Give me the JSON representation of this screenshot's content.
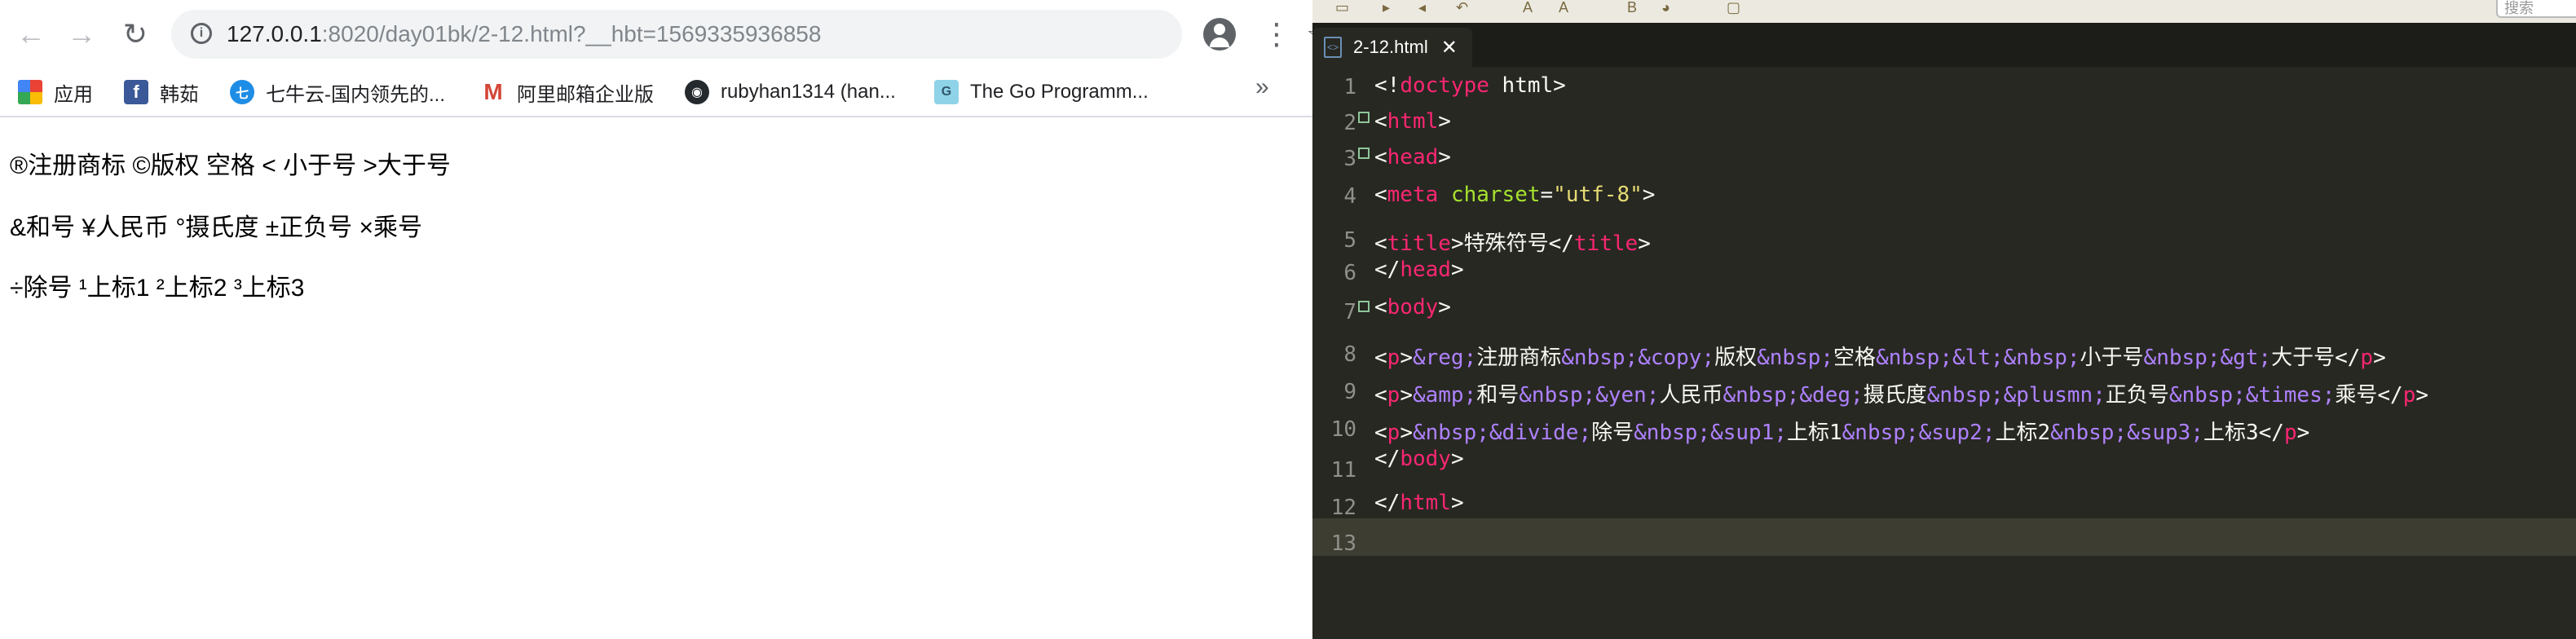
{
  "browser": {
    "url_host": "127.0.0.1",
    "url_rest": ":8020/day01bk/2-12.html?__hbt=1569335936858",
    "bookmarks": [
      {
        "label": "应用",
        "icon": "apps-grid-icon"
      },
      {
        "label": "韩茹",
        "icon": "facebook-icon"
      },
      {
        "label": "七牛云-国内领先的...",
        "icon": "qiniu-icon"
      },
      {
        "label": "阿里邮箱企业版",
        "icon": "gmail-icon"
      },
      {
        "label": "rubyhan1314 (han...",
        "icon": "github-icon"
      },
      {
        "label": "The Go Programm...",
        "icon": "gopher-icon"
      }
    ],
    "more_label": "»",
    "content_lines": [
      "®注册商标 ©版权 空格 < 小于号 >大于号",
      "&和号 ¥人民币 °摄氏度 ±正负号 ×乘号",
      " ÷除号 ¹上标1 ²上标2 ³上标3"
    ]
  },
  "editor": {
    "tab_title": "2-12.html",
    "tab_close": "✕",
    "search_placeholder": "搜索",
    "line_numbers": [
      "1",
      "2",
      "3",
      "4",
      "5",
      "6",
      "7",
      "8",
      "9",
      "10",
      "11",
      "12",
      "13"
    ],
    "code_lines": [
      "<!doctype html>",
      "<html>",
      "<head>",
      "<meta charset=\"utf-8\">",
      "<title>特殊符号</title>",
      "</head>",
      "<body>",
      "<p>&reg;注册商标&nbsp;&copy;版权&nbsp;空格&nbsp;&lt;&nbsp;小于号&nbsp;&gt;大于号</p>",
      "<p>&amp;和号&nbsp;&yen;人民币&nbsp;&deg;摄氏度&nbsp;&plusmn;正负号&nbsp;&times;乘号</p>",
      "<p>&nbsp;&divide;除号&nbsp;&sup1;上标1&nbsp;&sup2;上标2&nbsp;&sup3;上标3</p>",
      "</body>",
      "</html>",
      ""
    ]
  },
  "colors": {
    "editor_bg": "#272822",
    "tag": "#f92672",
    "attr": "#a6e22e",
    "string": "#e6db74",
    "entity": "#ae81ff"
  }
}
